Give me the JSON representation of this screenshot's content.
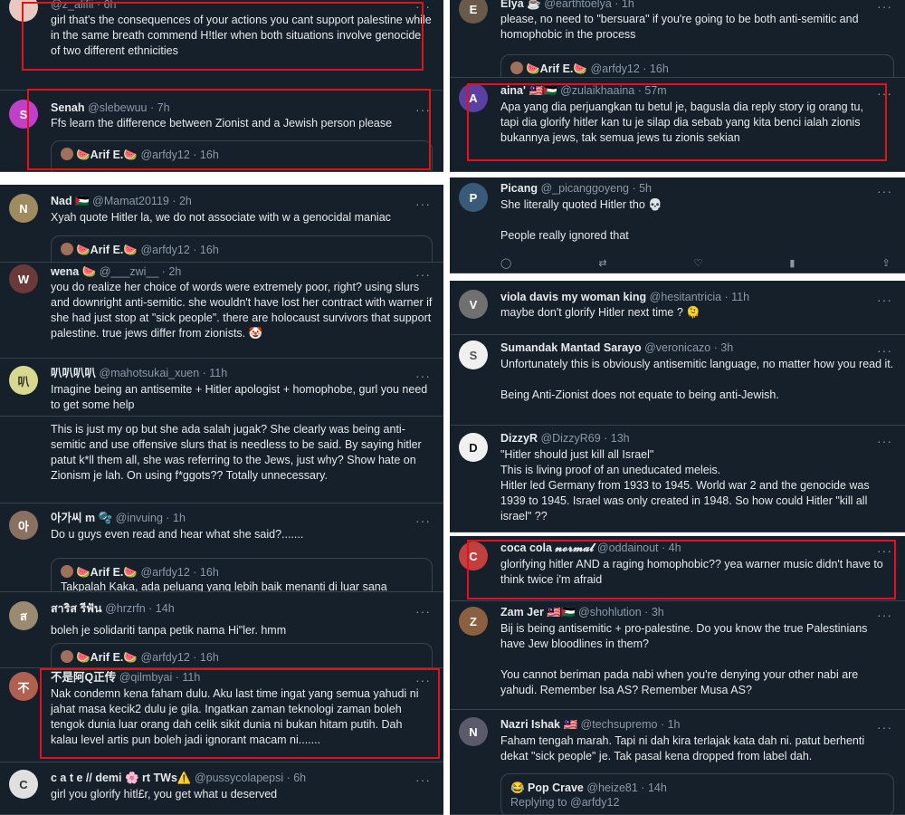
{
  "left": [
    {
      "handle": "@z_alifii · 6h",
      "avatar": "",
      "text": "girl that's the consequences of your actions you cant support palestine while in the same breath commend H!tler when both situations involve genocide of two different ethnicities"
    },
    {
      "name": "Senah",
      "handle": "@slebewuu · 7h",
      "avatar": "S",
      "avatar_color": "#c040c8",
      "text": "Ffs learn the difference between Zionist and a Jewish person please",
      "quote_name": "🍉Arif E.🍉",
      "quote_handle": "@arfdy12 · 16h"
    },
    {
      "name": "Nad 🇵🇸",
      "handle": "@Mamat20119 · 2h",
      "avatar": "N",
      "avatar_color": "#a08a60",
      "text": "Xyah quote Hitler la, we do not associate with w a genocidal maniac",
      "quote_name": "🍉Arif E.🍉",
      "quote_handle": "@arfdy12 · 16h"
    },
    {
      "name": "wena 🍉",
      "handle": "@___zwi__ · 2h",
      "avatar": "W",
      "avatar_color": "#6a3a3a",
      "text": "you do realize her choice of words were extremely poor, right? using slurs and downright anti-semitic. she wouldn't have lost her contract with warner if she had just stop at \"sick people\". there are holocaust survivors that support palestine. true jews differ from zionists. 🤡"
    },
    {
      "name": "叭叭叭叭",
      "handle": "@mahotsukai_xuen · 11h",
      "avatar": "叭",
      "avatar_color": "#d8d890",
      "text": "Imagine being an antisemite + Hitler apologist + homophobe, gurl you need to get some help"
    },
    {
      "text": "This is just my op but she ada salah jugak? She clearly was being anti-semitic and use offensive slurs that is needless to be said. By saying hitler patut k*ll them all, she was referring to the Jews, just why? Show hate on Zionism je lah. On using f*ggots?? Totally unnecessary."
    },
    {
      "name": "아가씨 m 🫧",
      "handle": "@invuing · 1h",
      "avatar": "아",
      "avatar_color": "#8a7060",
      "text": "Do u guys even read and hear what she said?.......",
      "quote_name": "🍉Arif E.🍉",
      "quote_handle": "@arfdy12 · 16h",
      "quote_text": "Takpalah Kaka, ada peluang yang lebih baik menanti di luar sana"
    },
    {
      "name": "สาริส รีฟัน",
      "handle": "@hrzrfn · 14h",
      "avatar": "ส",
      "avatar_color": "#9a8a70",
      "text": "boleh je solidariti tanpa petik nama Hi\"ler. hmm",
      "quote_name": "🍉Arif E.🍉",
      "quote_handle": "@arfdy12 · 16h"
    },
    {
      "name": "不是阿Q正传",
      "handle": "@qilmbyai · 11h",
      "avatar": "不",
      "avatar_color": "#b06050",
      "text": "Nak condemn kena faham dulu. Aku last time ingat yang semua yahudi ni jahat masa kecik2 dulu je gila. Ingatkan zaman teknologi zaman boleh tengok dunia luar orang dah celik sikit dunia ni bukan hitam putih. Dah kalau level artis pun boleh jadi ignorant macam ni......."
    },
    {
      "name": "c a t e // demi 🌸 rt TWs⚠️",
      "handle": "@pussycolapepsi · 6h",
      "avatar": "C",
      "avatar_color": "#e0e0e0",
      "text": "girl you glorify hitl£r, you get what u deserved"
    }
  ],
  "right": [
    {
      "name": "Elya ☕",
      "handle": "@earthtoelya · 1h",
      "avatar": "E",
      "avatar_color": "#6a5a4a",
      "text": "please, no need to \"bersuara\" if you're going to be both anti-semitic and homophobic in the process",
      "quote_name": "🍉Arif E.🍉",
      "quote_handle": "@arfdy12 · 16h"
    },
    {
      "name": "aina' 🇲🇾🇵🇸",
      "handle": "@zulaikhaaina · 57m",
      "avatar": "A",
      "avatar_color": "#5a40a0",
      "text": "Apa yang dia perjuangkan tu betul je, bagusla dia reply story ig orang tu, tapi dia glorify hitler kan tu je silap dia  sebab yang kita benci ialah zionis bukannya jews, tak semua jews tu zionis sekian"
    },
    {
      "name": "Picang",
      "handle": "@_picanggoyeng · 5h",
      "avatar": "P",
      "avatar_color": "#3a5a7a",
      "text": "She literally quoted Hitler tho 💀\n\nPeople really ignored that"
    },
    {
      "name": "viola davis my woman king",
      "handle": "@hesitantricia · 11h",
      "avatar": "V",
      "avatar_color": "#707070",
      "text": "maybe don't glorify Hitler next time ? 🫠"
    },
    {
      "name": "Sumandak Mantad Sarayo",
      "handle": "@veronicazo · 3h",
      "avatar": "S",
      "avatar_color": "#f0f0f0",
      "text": "Unfortunately this is obviously antisemitic language, no matter how you read it.\n\nBeing Anti-Zionist does not equate to being anti-Jewish."
    },
    {
      "name": "DizzyR",
      "handle": "@DizzyR69 · 13h",
      "avatar": "D",
      "avatar_color": "#f0f0f0",
      "text": "\"Hitler should just kill all Israel\"\nThis is living proof of an uneducated meleis.\nHitler led Germany from 1933 to 1945. World war 2 and the genocide was 1939 to 1945. Israel was only created in 1948. So how could Hitler \"kill all israel\" ??"
    },
    {
      "name": "coca cola 𝓷𝓸𝓻𝓶𝓪𝓵",
      "handle": "@oddainout · 4h",
      "avatar": "C",
      "avatar_color": "#c04040",
      "text": "glorifying hitler AND a raging homophobic?? yea warner music didn't have to think twice i'm afraid"
    },
    {
      "name": "Zam Jer 🇲🇾🇵🇸",
      "handle": "@shohlution · 3h",
      "avatar": "Z",
      "avatar_color": "#8a6040",
      "text": "Bij is being antisemitic + pro-palestine. Do you know the true Palestinians have Jew bloodlines in them?\n\nYou cannot beriman pada nabi when you're denying your other nabi are yahudi. Remember Isa AS? Remember Musa AS?"
    },
    {
      "name": "Nazri Ishak 🇲🇾",
      "handle": "@techsupremo · 1h",
      "avatar": "N",
      "avatar_color": "#5a5a6a",
      "text": "Faham tengah marah. Tapi ni dah kira terlajak kata dah ni. patut berhenti dekat \"sick people\" je. Tak pasal kena dropped from label dah.",
      "quote_name": "😂 Pop Crave",
      "quote_handle": "@heize81 · 14h",
      "quote_text": "Replying to @arfdy12"
    }
  ]
}
